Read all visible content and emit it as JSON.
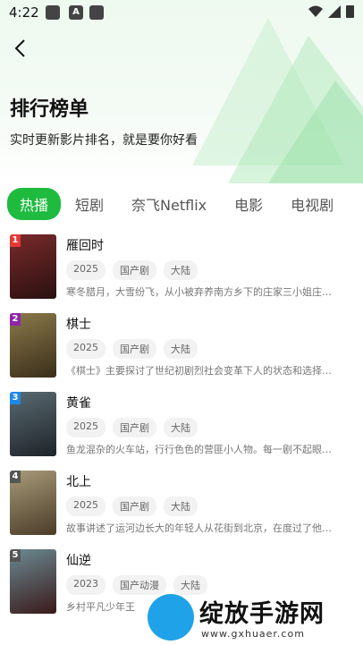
{
  "status": {
    "time": "4:22"
  },
  "header": {
    "title": "排行榜单",
    "subtitle": "实时更新影片排名，就是要你好看"
  },
  "tabs": [
    {
      "label": "热播",
      "active": true
    },
    {
      "label": "短剧",
      "active": false
    },
    {
      "label": "奈飞Netflix",
      "active": false
    },
    {
      "label": "电影",
      "active": false
    },
    {
      "label": "电视剧",
      "active": false
    }
  ],
  "items": [
    {
      "rank": "1",
      "title": "雁回时",
      "tags": [
        "2025",
        "国产剧",
        "大陆"
      ],
      "desc": "寒冬腊月，大雪纷飞，从小被弃养南方乡下的庄家三小姐庄…",
      "rank_color": "#e53935",
      "poster_color": "#4b1f20"
    },
    {
      "rank": "2",
      "title": "棋士",
      "tags": [
        "2025",
        "国产剧",
        "大陆"
      ],
      "desc": "《棋士》主要探讨了世纪初剧烈社会变革下人的状态和选择…",
      "rank_color": "#8e24aa",
      "poster_color": "#5b4a2a"
    },
    {
      "rank": "3",
      "title": "黄雀",
      "tags": [
        "2025",
        "国产剧",
        "大陆"
      ],
      "desc": "鱼龙混杂的火车站，行行色色的营匪小人物。每一剧不起眼…",
      "rank_color": "#1e88e5",
      "poster_color": "#2e3a43"
    },
    {
      "rank": "4",
      "title": "北上",
      "tags": [
        "2025",
        "国产剧",
        "大陆"
      ],
      "desc": "故事讲述了运河边长大的年轻人从花街到北京，在度过了他…",
      "rank_color": "#555555",
      "poster_color": "#6d5b40"
    },
    {
      "rank": "5",
      "title": "仙逆",
      "tags": [
        "2023",
        "国产动漫",
        "大陆"
      ],
      "desc": "乡村平凡少年王",
      "rank_color": "#555555",
      "poster_color": "#3a4a52"
    }
  ],
  "watermark": {
    "text": "绽放手游网",
    "url": "www.gxhuaer.com"
  }
}
